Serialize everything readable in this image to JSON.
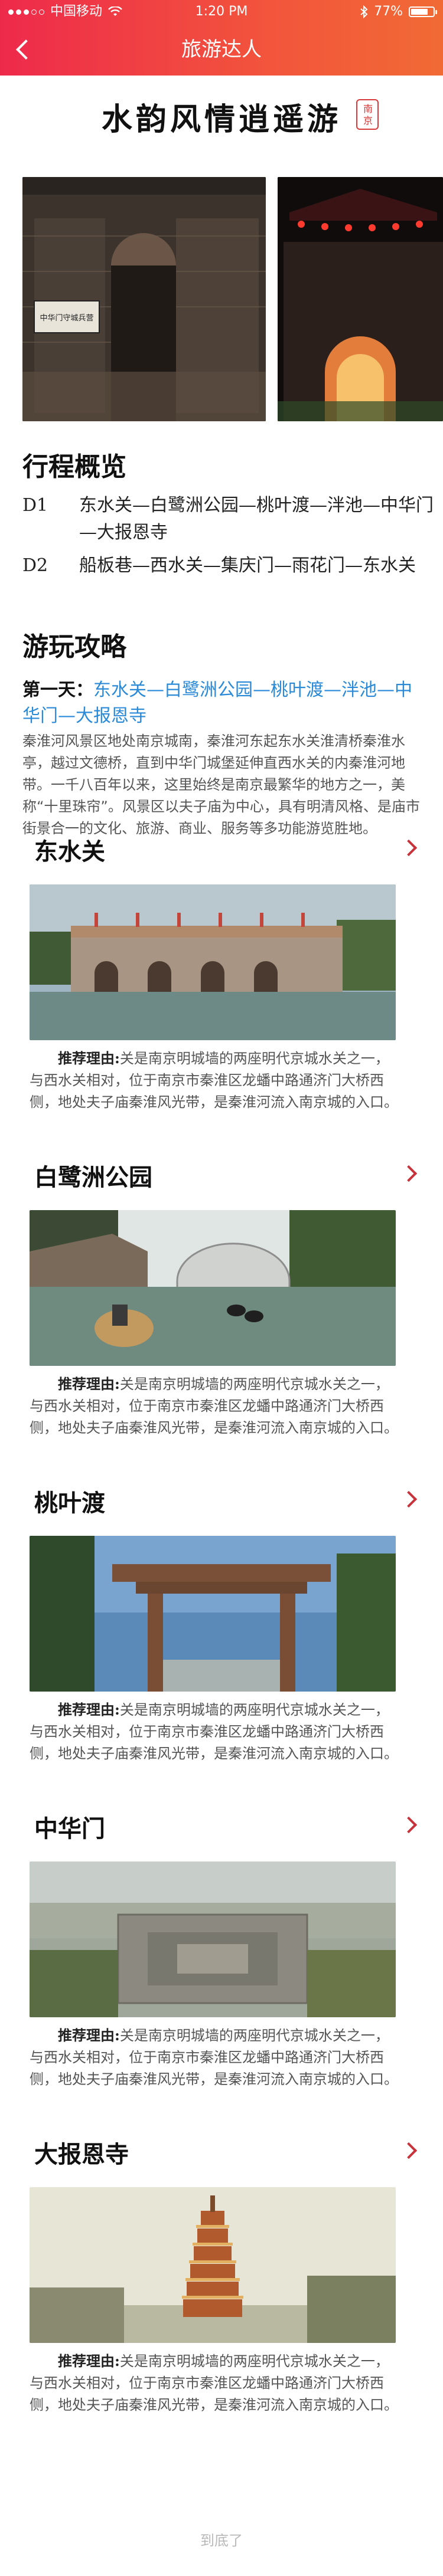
{
  "status": {
    "carrier": "中国移动",
    "time": "1:20 PM",
    "battery": "77%",
    "battery_level": 0.77
  },
  "nav": {
    "title": "旅游达人"
  },
  "page": {
    "title": "水韵风情逍遥游",
    "seal_text": "南京"
  },
  "hero": {
    "left_sign": "中华门守城兵营",
    "icons": [
      "photo-city-gate-left",
      "photo-city-gate-night"
    ]
  },
  "overview": {
    "heading": "行程概览",
    "items": [
      {
        "code": "D1",
        "route": "东水关—白鹭洲公园—桃叶渡—泮池—中华门—大报恩寺"
      },
      {
        "code": "D2",
        "route": "船板巷—西水关—集庆门—雨花门—东水关"
      }
    ]
  },
  "guide": {
    "heading": "游玩攻略",
    "day_label": "第一天：",
    "day_route": "东水关—白鹭洲公园—桃叶渡—泮池—中华门—大报恩寺",
    "intro": "秦淮河风景区地处南京城南，秦淮河东起东水关淮清桥秦淮水亭，越过文德桥，直到中华门城堡延伸直西水关的内秦淮河地带。一千八百年以来，这里始终是南京最繁华的地方之一，美称“十里珠帘”。风景区以夫子庙为中心，具有明清风格、是庙市街景合一的文化、旅游、商业、服务等多功能游览胜地。"
  },
  "spots": [
    {
      "name": "东水关",
      "reason_label": "推荐理由:",
      "reason": "关是南京明城墙的两座明代京城水关之一，与西水关相对，位于南京市秦淮区龙蟠中路通济门大桥西侧，地处夫子庙秦淮风光带，是秦淮河流入南京城的入口。"
    },
    {
      "name": "白鹭洲公园",
      "reason_label": "推荐理由:",
      "reason": "关是南京明城墙的两座明代京城水关之一，与西水关相对，位于南京市秦淮区龙蟠中路通济门大桥西侧，地处夫子庙秦淮风光带，是秦淮河流入南京城的入口。"
    },
    {
      "name": "桃叶渡",
      "reason_label": "推荐理由:",
      "reason": "关是南京明城墙的两座明代京城水关之一，与西水关相对，位于南京市秦淮区龙蟠中路通济门大桥西侧，地处夫子庙秦淮风光带，是秦淮河流入南京城的入口。"
    },
    {
      "name": "中华门",
      "reason_label": "推荐理由:",
      "reason": "关是南京明城墙的两座明代京城水关之一，与西水关相对，位于南京市秦淮区龙蟠中路通济门大桥西侧，地处夫子庙秦淮风光带，是秦淮河流入南京城的入口。"
    },
    {
      "name": "大报恩寺",
      "reason_label": "推荐理由:",
      "reason": "关是南京明城墙的两座明代京城水关之一，与西水关相对，位于南京市秦淮区龙蟠中路通济门大桥西侧，地处夫子庙秦淮风光带，是秦淮河流入南京城的入口。"
    }
  ],
  "footer": {
    "text": "到底了"
  },
  "colors": {
    "accent_start": "#ee2a4b",
    "accent_end": "#f16a34",
    "link": "#2a8ad8",
    "chevron": "#c8323a"
  }
}
